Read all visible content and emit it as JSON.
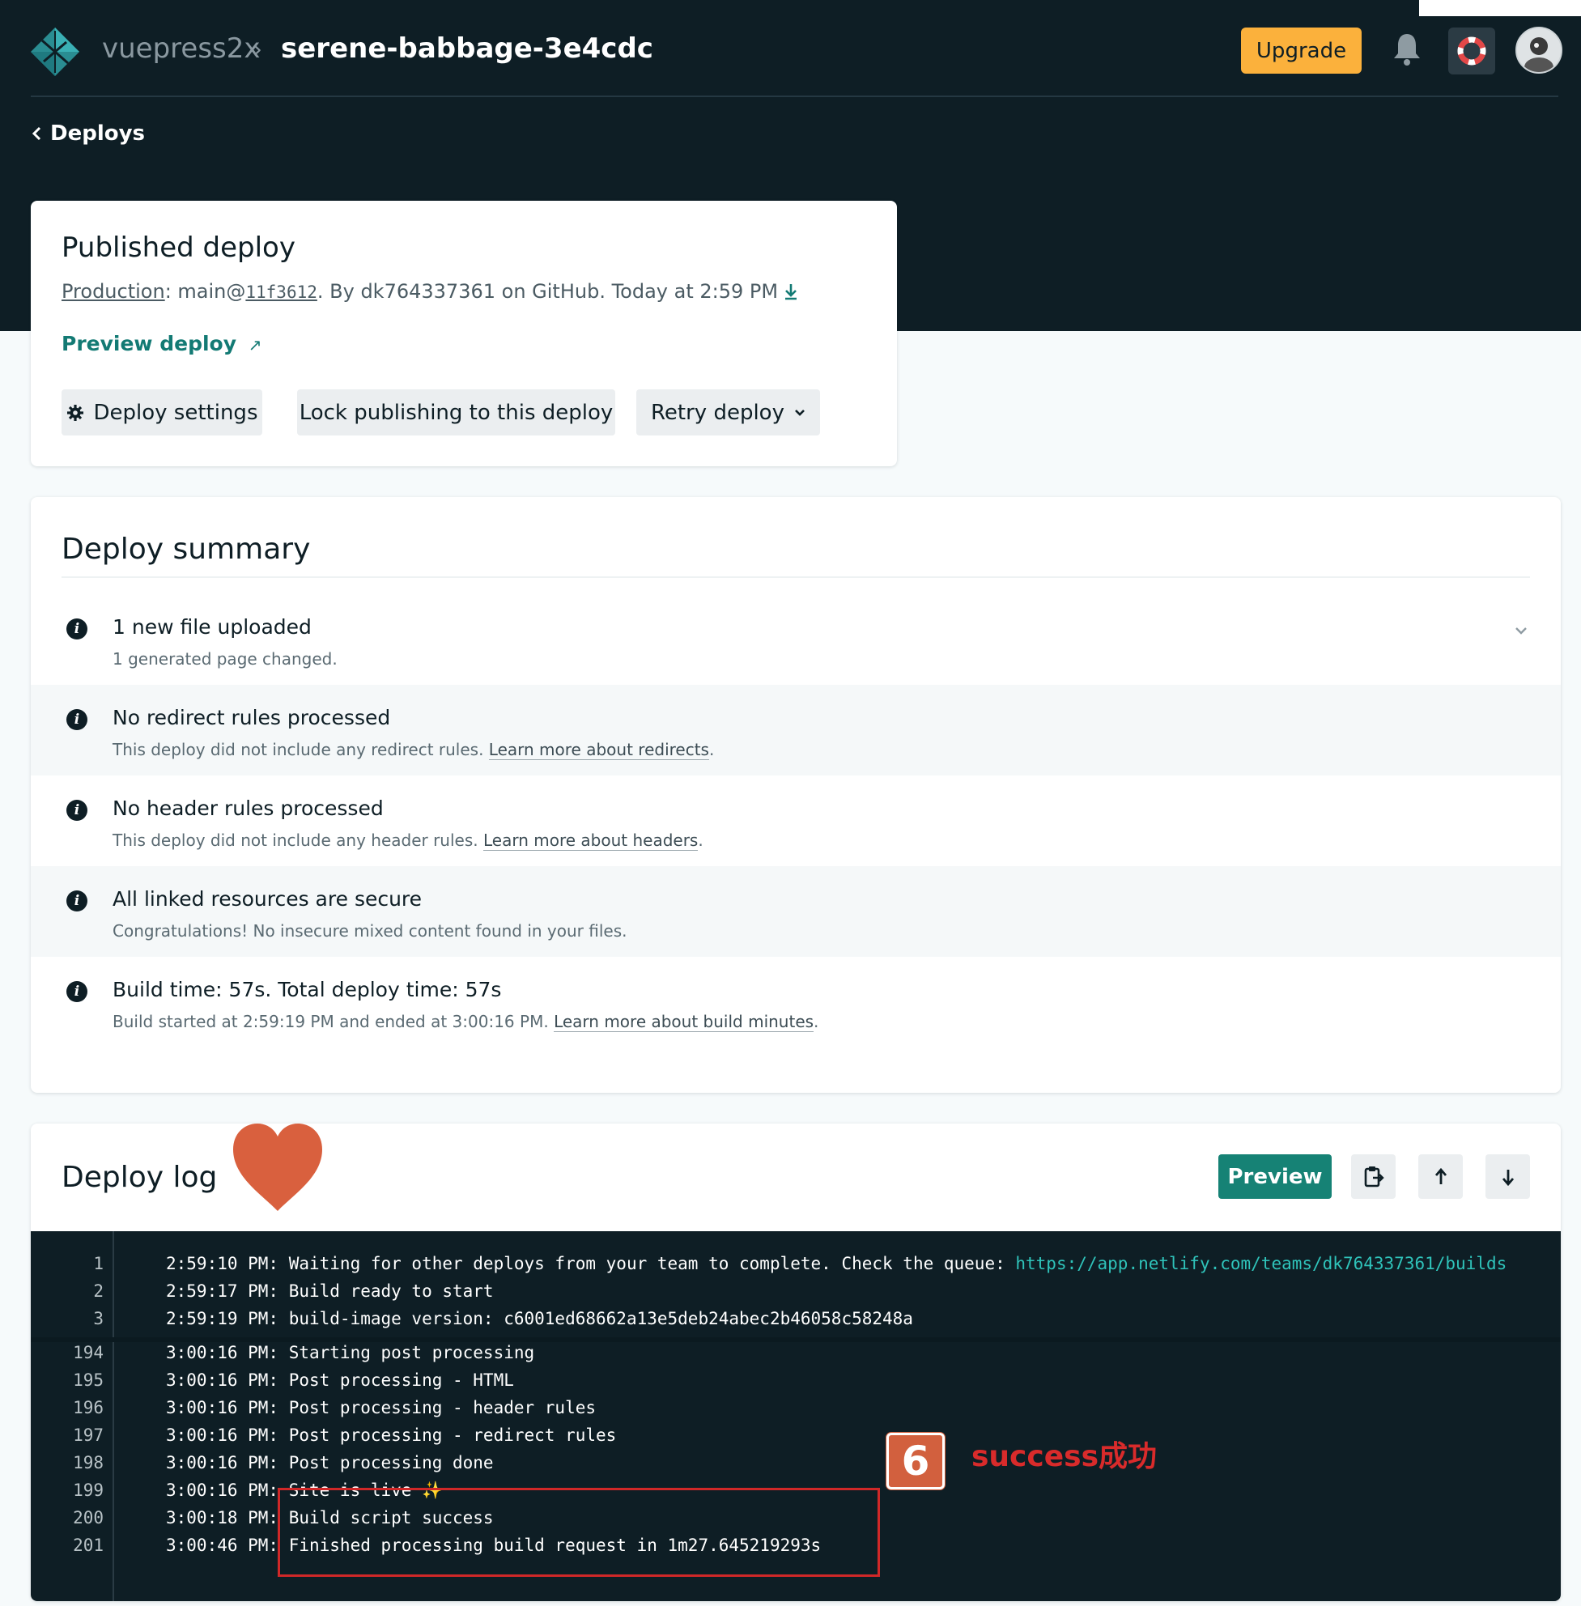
{
  "header": {
    "site": "vuepress2x",
    "separator": "›",
    "page": "serene-babbage-3e4cdc",
    "upgrade_label": "Upgrade",
    "back_label": "Deploys"
  },
  "published": {
    "title": "Published deploy",
    "context_label": "Production",
    "branch": "main@",
    "commit": "11f3612",
    "byline": ". By dk764337361 on GitHub. Today at 2:59 PM",
    "preview_label": "Preview deploy",
    "preview_icon": "↗",
    "buttons": {
      "settings": "Deploy settings",
      "lock": "Lock publishing to this deploy",
      "retry": "Retry deploy"
    }
  },
  "summary": {
    "title": "Deploy summary",
    "items": [
      {
        "title": "1 new file uploaded",
        "detail": "1 generated page changed.",
        "link": "",
        "tail": ""
      },
      {
        "title": "No redirect rules processed",
        "detail": "This deploy did not include any redirect rules. ",
        "link": "Learn more about redirects",
        "tail": "."
      },
      {
        "title": "No header rules processed",
        "detail": "This deploy did not include any header rules. ",
        "link": "Learn more about headers",
        "tail": "."
      },
      {
        "title": "All linked resources are secure",
        "detail": "Congratulations! No insecure mixed content found in your files.",
        "link": "",
        "tail": ""
      },
      {
        "title": "Build time: 57s. Total deploy time: 57s",
        "detail": "Build started at 2:59:19 PM and ended at 3:00:16 PM. ",
        "link": "Learn more about build minutes",
        "tail": "."
      }
    ]
  },
  "log": {
    "title": "Deploy log",
    "preview_label": "Preview",
    "lines": [
      {
        "n": "1",
        "text": "2:59:10 PM: Waiting for other deploys from your team to complete. Check the queue: ",
        "url": "https://app.netlify.com/teams/dk764337361/builds"
      },
      {
        "n": "2",
        "text": "2:59:17 PM: Build ready to start",
        "url": ""
      },
      {
        "n": "3",
        "text": "2:59:19 PM: build-image version: c6001ed68662a13e5deb24abec2b46058c58248a",
        "url": ""
      },
      {
        "n": "194",
        "text": "3:00:16 PM: Starting post processing",
        "url": ""
      },
      {
        "n": "195",
        "text": "3:00:16 PM: Post processing - HTML",
        "url": ""
      },
      {
        "n": "196",
        "text": "3:00:16 PM: Post processing - header rules",
        "url": ""
      },
      {
        "n": "197",
        "text": "3:00:16 PM: Post processing - redirect rules",
        "url": ""
      },
      {
        "n": "198",
        "text": "3:00:16 PM: Post processing done",
        "url": ""
      },
      {
        "n": "199",
        "text": "3:00:16 PM: Site is live ✨",
        "url": ""
      },
      {
        "n": "200",
        "text": "3:00:18 PM: Build script success",
        "url": ""
      },
      {
        "n": "201",
        "text": "3:00:46 PM: Finished processing build request in 1m27.645219293s",
        "url": ""
      }
    ]
  },
  "annotation": {
    "badge": "6",
    "text": "success成功"
  },
  "colors": {
    "header_bg": "#0e1e25",
    "accent_teal": "#168275",
    "upgrade": "#fbb13c",
    "annotation_red": "#d02828",
    "badge": "#d2603e",
    "heart": "#d9603e"
  }
}
